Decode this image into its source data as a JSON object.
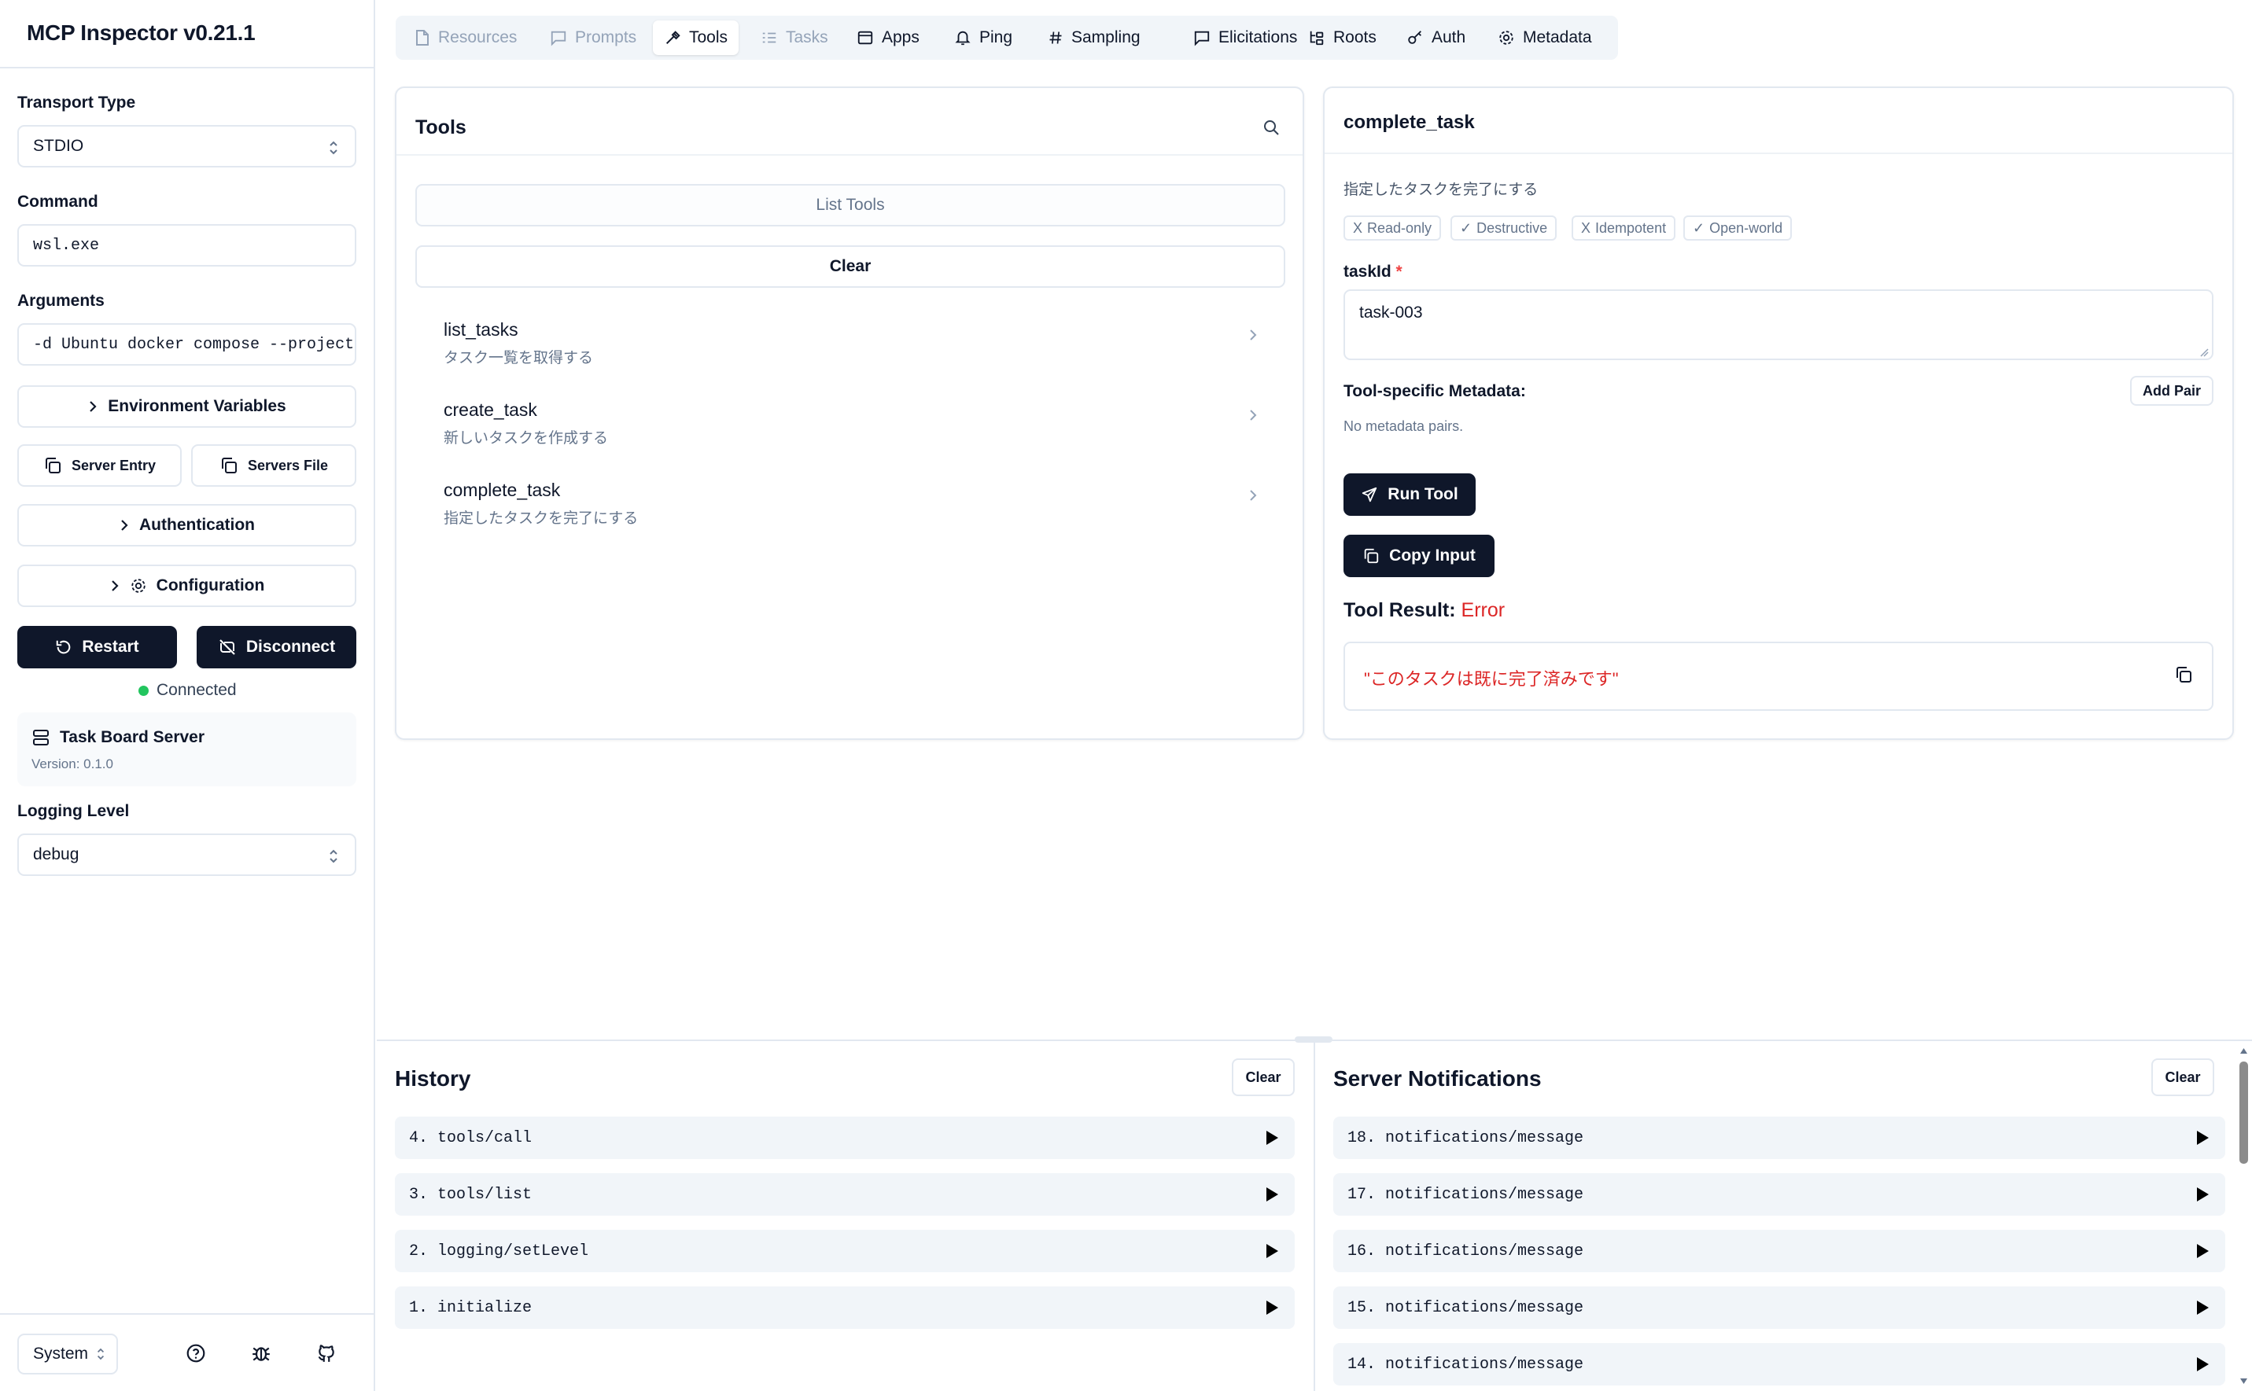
{
  "app": {
    "title": "MCP Inspector v0.21.1"
  },
  "sidebar": {
    "transport_label": "Transport Type",
    "transport_value": "STDIO",
    "command_label": "Command",
    "command_value": "wsl.exe",
    "arguments_label": "Arguments",
    "arguments_value": "-d Ubuntu docker compose --project",
    "env_button": "Environment Variables",
    "server_entry_button": "Server Entry",
    "servers_file_button": "Servers File",
    "auth_button": "Authentication",
    "config_button": "Configuration",
    "restart_button": "Restart",
    "disconnect_button": "Disconnect",
    "status": "Connected",
    "server_name": "Task Board Server",
    "server_version": "Version: 0.1.0",
    "logging_label": "Logging Level",
    "logging_value": "debug",
    "theme_value": "System"
  },
  "tabs": [
    {
      "label": "Resources",
      "icon": "file-icon",
      "state": "disabled"
    },
    {
      "label": "Prompts",
      "icon": "message-icon",
      "state": "disabled"
    },
    {
      "label": "Tools",
      "icon": "hammer-icon",
      "state": "active"
    },
    {
      "label": "Tasks",
      "icon": "list-icon",
      "state": "disabled"
    },
    {
      "label": "Apps",
      "icon": "window-icon",
      "state": "enabled"
    },
    {
      "label": "Ping",
      "icon": "bell-icon",
      "state": "enabled"
    },
    {
      "label": "Sampling",
      "icon": "hash-icon",
      "state": "enabled"
    },
    {
      "label": "Elicitations",
      "icon": "message-icon",
      "state": "enabled"
    },
    {
      "label": "Roots",
      "icon": "folder-tree-icon",
      "state": "enabled"
    },
    {
      "label": "Auth",
      "icon": "key-icon",
      "state": "enabled"
    },
    {
      "label": "Metadata",
      "icon": "gear-icon",
      "state": "enabled"
    }
  ],
  "tools_panel": {
    "title": "Tools",
    "list_button": "List Tools",
    "clear_button": "Clear",
    "items": [
      {
        "name": "list_tasks",
        "description": "タスク一覧を取得する"
      },
      {
        "name": "create_task",
        "description": "新しいタスクを作成する"
      },
      {
        "name": "complete_task",
        "description": "指定したタスクを完了にする"
      }
    ]
  },
  "detail": {
    "title": "complete_task",
    "description": "指定したタスクを完了にする",
    "badges": [
      {
        "mark": "X",
        "label": "Read-only"
      },
      {
        "mark": "✓",
        "label": "Destructive"
      },
      {
        "mark": "X",
        "label": "Idempotent"
      },
      {
        "mark": "✓",
        "label": "Open-world"
      }
    ],
    "param_label": "taskId",
    "param_required_mark": "*",
    "param_value": "task-003",
    "meta_label": "Tool-specific Metadata:",
    "add_pair": "Add Pair",
    "meta_empty": "No metadata pairs.",
    "run_button": "Run Tool",
    "copy_button": "Copy Input",
    "result_label": "Tool Result:",
    "result_status": "Error",
    "result_text": "\"このタスクは既に完了済みです\""
  },
  "history": {
    "title": "History",
    "clear": "Clear",
    "items": [
      "4. tools/call",
      "3. tools/list",
      "2. logging/setLevel",
      "1. initialize"
    ]
  },
  "notifications": {
    "title": "Server Notifications",
    "clear": "Clear",
    "items": [
      "18. notifications/message",
      "17. notifications/message",
      "16. notifications/message",
      "15. notifications/message",
      "14. notifications/message"
    ]
  },
  "colors": {
    "primary": "#0f172a",
    "error": "#dc2626",
    "connected": "#22c55e",
    "border": "#e2e8f0"
  }
}
